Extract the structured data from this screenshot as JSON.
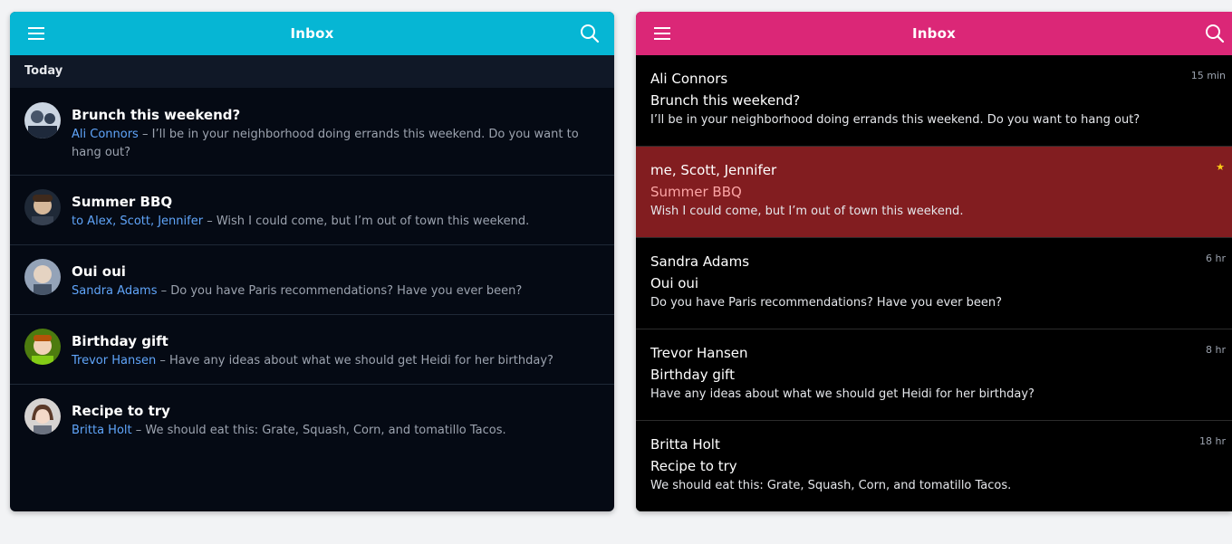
{
  "left": {
    "title": "Inbox",
    "accent": "#06b6d4",
    "subheader": "Today",
    "separator": " – ",
    "items": [
      {
        "title": "Brunch this weekend?",
        "sender": "Ali Connors",
        "preview": "I’ll be in your neighborhood doing errands this weekend. Do you want to hang out?",
        "avatar_color": "#6b7280"
      },
      {
        "title": "Summer BBQ",
        "sender": "to Alex, Scott, Jennifer",
        "preview": "Wish I could come, but I’m out of town this weekend.",
        "avatar_color": "#4b5563"
      },
      {
        "title": "Oui oui",
        "sender": "Sandra Adams",
        "preview": "Do you have Paris recommendations? Have you ever been?",
        "avatar_color": "#64748b"
      },
      {
        "title": "Birthday gift",
        "sender": "Trevor Hansen",
        "preview": "Have any ideas about what we should get Heidi for her birthday?",
        "avatar_color": "#65a30d"
      },
      {
        "title": "Recipe to try",
        "sender": "Britta Holt",
        "preview": "We should eat this: Grate, Squash, Corn, and tomatillo Tacos.",
        "avatar_color": "#a8a29e"
      }
    ]
  },
  "right": {
    "title": "Inbox",
    "accent": "#db2777",
    "items": [
      {
        "from": "Ali Connors",
        "subject": "Brunch this weekend?",
        "preview": "I’ll be in your neighborhood doing errands this weekend. Do you want to hang out?",
        "time": "15 min",
        "starred": false,
        "selected": false
      },
      {
        "from": "me, Scott, Jennifer",
        "subject": "Summer BBQ",
        "preview": "Wish I could come, but I’m out of town this weekend.",
        "time": "",
        "starred": true,
        "star": "★",
        "selected": true
      },
      {
        "from": "Sandra Adams",
        "subject": "Oui oui",
        "preview": "Do you have Paris recommendations? Have you ever been?",
        "time": "6 hr",
        "starred": false,
        "selected": false
      },
      {
        "from": "Trevor Hansen",
        "subject": "Birthday gift",
        "preview": "Have any ideas about what we should get Heidi for her birthday?",
        "time": "8 hr",
        "starred": false,
        "selected": false
      },
      {
        "from": "Britta Holt",
        "subject": "Recipe to try",
        "preview": "We should eat this: Grate, Squash, Corn, and tomatillo Tacos.",
        "time": "18 hr",
        "starred": false,
        "selected": false
      }
    ]
  }
}
